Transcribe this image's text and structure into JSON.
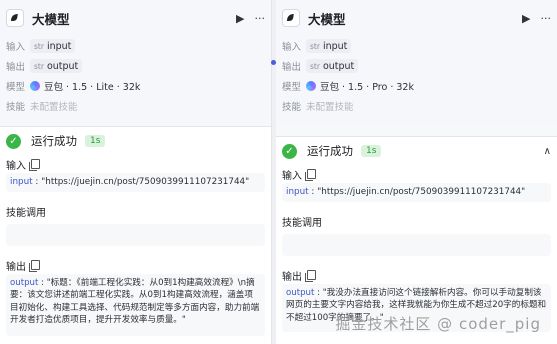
{
  "left": {
    "node": {
      "title": "大模型",
      "logo_icon": "bird-icon"
    },
    "meta": {
      "input_key": "输入",
      "input_type": "str",
      "input_value": "input",
      "output_key": "输出",
      "output_type": "str",
      "output_value": "output",
      "model_key": "模型",
      "model_value": "豆包 · 1.5 · Lite · 32k",
      "skill_key": "技能",
      "skill_value": "未配置技能"
    },
    "result": {
      "status": "运行成功",
      "duration": "1s",
      "input_title": "输入",
      "input_json_key": "input",
      "input_json_value": "\"https://juejin.cn/post/7509039911107231744\"",
      "skill_title": "技能调用",
      "output_title": "输出",
      "output_json_key": "output",
      "output_json_value": "\"标题：《前端工程化实践：从0到1构建高效流程》\\n摘要：该文您讲述前端工程化实践。从0到1构建高效流程，涵盖项目初始化、构建工具选择、代码规范制定等多方面内容，助力前端开发者打造优质项目，提升开发效率与质量。\""
    }
  },
  "right": {
    "node": {
      "title": "大模型",
      "logo_icon": "bird-icon"
    },
    "meta": {
      "input_key": "输入",
      "input_type": "str",
      "input_value": "input",
      "output_key": "输出",
      "output_type": "str",
      "output_value": "output",
      "model_key": "模型",
      "model_value": "豆包 · 1.5 · Pro · 32k",
      "skill_key": "技能",
      "skill_value": "未配置技能"
    },
    "result": {
      "status": "运行成功",
      "duration": "1s",
      "input_title": "输入",
      "input_json_key": "input",
      "input_json_value": "\"https://juejin.cn/post/7509039911107231744\"",
      "skill_title": "技能调用",
      "output_title": "输出",
      "output_json_key": "output",
      "output_json_value": "\"我没办法直接访问这个链接解析内容。你可以手动复制该网页的主要文字内容给我，这样我就能为你生成不超过20字的标题和不超过100字的摘要了。\""
    }
  },
  "watermark": "掘金技术社区 @ coder_pig",
  "icons": {
    "play": "play-icon",
    "more": "more-icon",
    "success": "check-circle-icon",
    "copy": "copy-icon",
    "collapse": "chevron-up-icon"
  }
}
